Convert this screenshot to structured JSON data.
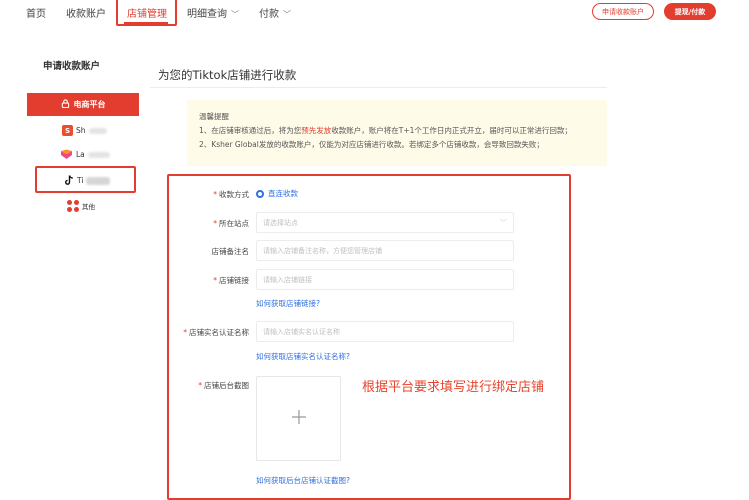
{
  "nav": {
    "items": [
      {
        "label": "首页",
        "dropdown": false
      },
      {
        "label": "收款账户",
        "dropdown": false
      },
      {
        "label": "店铺管理",
        "dropdown": false,
        "active": true
      },
      {
        "label": "明细查询",
        "dropdown": true
      },
      {
        "label": "付款",
        "dropdown": true
      }
    ],
    "apply_button": "申请收款账户",
    "withdraw_button": "提现/付款"
  },
  "sidebar": {
    "title": "申请收款账户",
    "ecommerce_label": "电商平台",
    "platforms": [
      {
        "name": "Sh",
        "icon": "shopee-icon"
      },
      {
        "name": "La",
        "icon": "lazada-icon"
      },
      {
        "name": "Ti",
        "icon": "tiktok-icon",
        "selected": true
      }
    ],
    "other_label": "其他"
  },
  "main": {
    "title": "为您的Tiktok店铺进行收款",
    "notice": {
      "heading": "温馨提醒",
      "line1_before": "1、在店铺审核通过后，将为您",
      "line1_highlight": "预先发放",
      "line1_after": "收款账户，账户将在T+1个工作日内正式开立，届时可以正常进行回款；",
      "line2": "2、Ksher Global发放的收款账户，仅能为对应店铺进行收款。若绑定多个店铺收款，会导致回款失败；"
    },
    "form": {
      "payment_method": {
        "label": "收款方式",
        "required": true,
        "value": "直连收款"
      },
      "site": {
        "label": "所在站点",
        "required": true,
        "placeholder": "请选择站点"
      },
      "store_note": {
        "label": "店铺备注名",
        "required": false,
        "placeholder": "请输入店铺备注名称，方便您管理店铺"
      },
      "store_link": {
        "label": "店铺链接",
        "required": true,
        "placeholder": "请输入店铺链接",
        "help": "如何获取店铺链接?"
      },
      "store_real_name": {
        "label": "店铺实名认证名称",
        "required": true,
        "placeholder": "请输入店铺实名认证名称",
        "help": "如何获取店铺实名认证名称?"
      },
      "backend_screenshot": {
        "label": "店铺后台截图",
        "required": true,
        "help": "如何获取后台店铺认证截图?"
      }
    },
    "annotation": "根据平台要求填写进行绑定店铺"
  },
  "colors": {
    "accent": "#e23d2e",
    "link": "#2f6fe0",
    "notice_bg": "#fffbe9"
  }
}
